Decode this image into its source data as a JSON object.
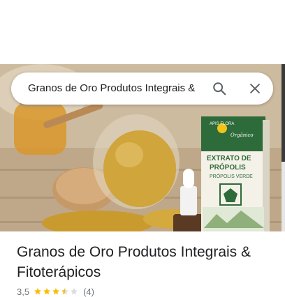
{
  "search": {
    "query": "Granos de Oro Produtos Integrais &",
    "search_icon": "search-icon",
    "close_icon": "close-icon"
  },
  "hero_image": {
    "description_icon": "product-photo",
    "box_brand": "APIS FLORA",
    "box_brand_sub": "Orgânico",
    "box_title_line1": "EXTRATO DE",
    "box_title_line2": "PRÓPOLIS",
    "box_subtitle": "PRÓPOLIS VERDE"
  },
  "place": {
    "title": "Granos de Oro Produtos Integrais & Fitoterápicos",
    "rating": "3,5",
    "rating_value": 3.5,
    "rating_max": 5,
    "review_count": "(4)"
  },
  "colors": {
    "star_filled": "#fbbc04",
    "star_empty": "#dadce0",
    "box_green": "#2e6b3a"
  }
}
